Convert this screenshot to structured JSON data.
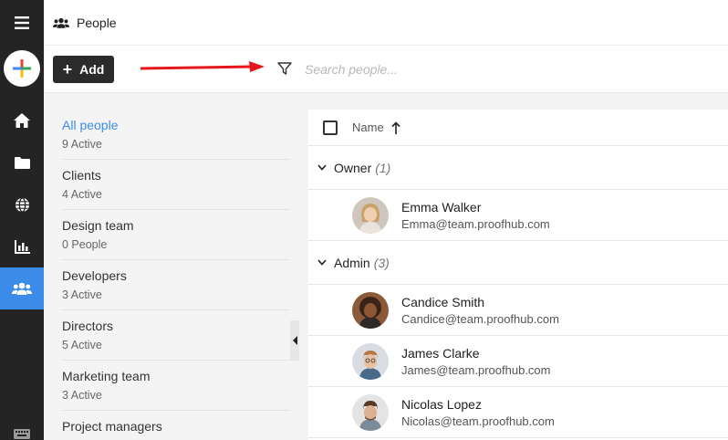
{
  "header": {
    "title": "People",
    "icon": "people-icon"
  },
  "toolbar": {
    "add_label": "Add",
    "search_placeholder": "Search people...",
    "annotation_color": "#e8171c"
  },
  "rail": {
    "items": [
      {
        "name": "menu-icon"
      },
      {
        "name": "quick-add-icon"
      },
      {
        "name": "home-icon"
      },
      {
        "name": "folder-icon"
      },
      {
        "name": "globe-icon"
      },
      {
        "name": "reports-icon"
      },
      {
        "name": "people-icon",
        "active": true
      },
      {
        "name": "keyboard-icon"
      }
    ],
    "active_color": "#3b8ce8"
  },
  "groups": [
    {
      "label": "All people",
      "count": "9 Active",
      "active": true
    },
    {
      "label": "Clients",
      "count": "4 Active"
    },
    {
      "label": "Design team",
      "count": "0 People"
    },
    {
      "label": "Developers",
      "count": "3 Active"
    },
    {
      "label": "Directors",
      "count": "5 Active"
    },
    {
      "label": "Marketing team",
      "count": "3 Active"
    },
    {
      "label": "Project managers",
      "count": ""
    }
  ],
  "table": {
    "column_name": "Name",
    "sections": [
      {
        "title": "Owner",
        "count": "(1)",
        "people": [
          {
            "name": "Emma Walker",
            "email": "Emma@team.proofhub.com"
          }
        ]
      },
      {
        "title": "Admin",
        "count": "(3)",
        "people": [
          {
            "name": "Candice Smith",
            "email": "Candice@team.proofhub.com"
          },
          {
            "name": "James Clarke",
            "email": "James@team.proofhub.com"
          },
          {
            "name": "Nicolas Lopez",
            "email": "Nicolas@team.proofhub.com"
          }
        ]
      }
    ]
  }
}
